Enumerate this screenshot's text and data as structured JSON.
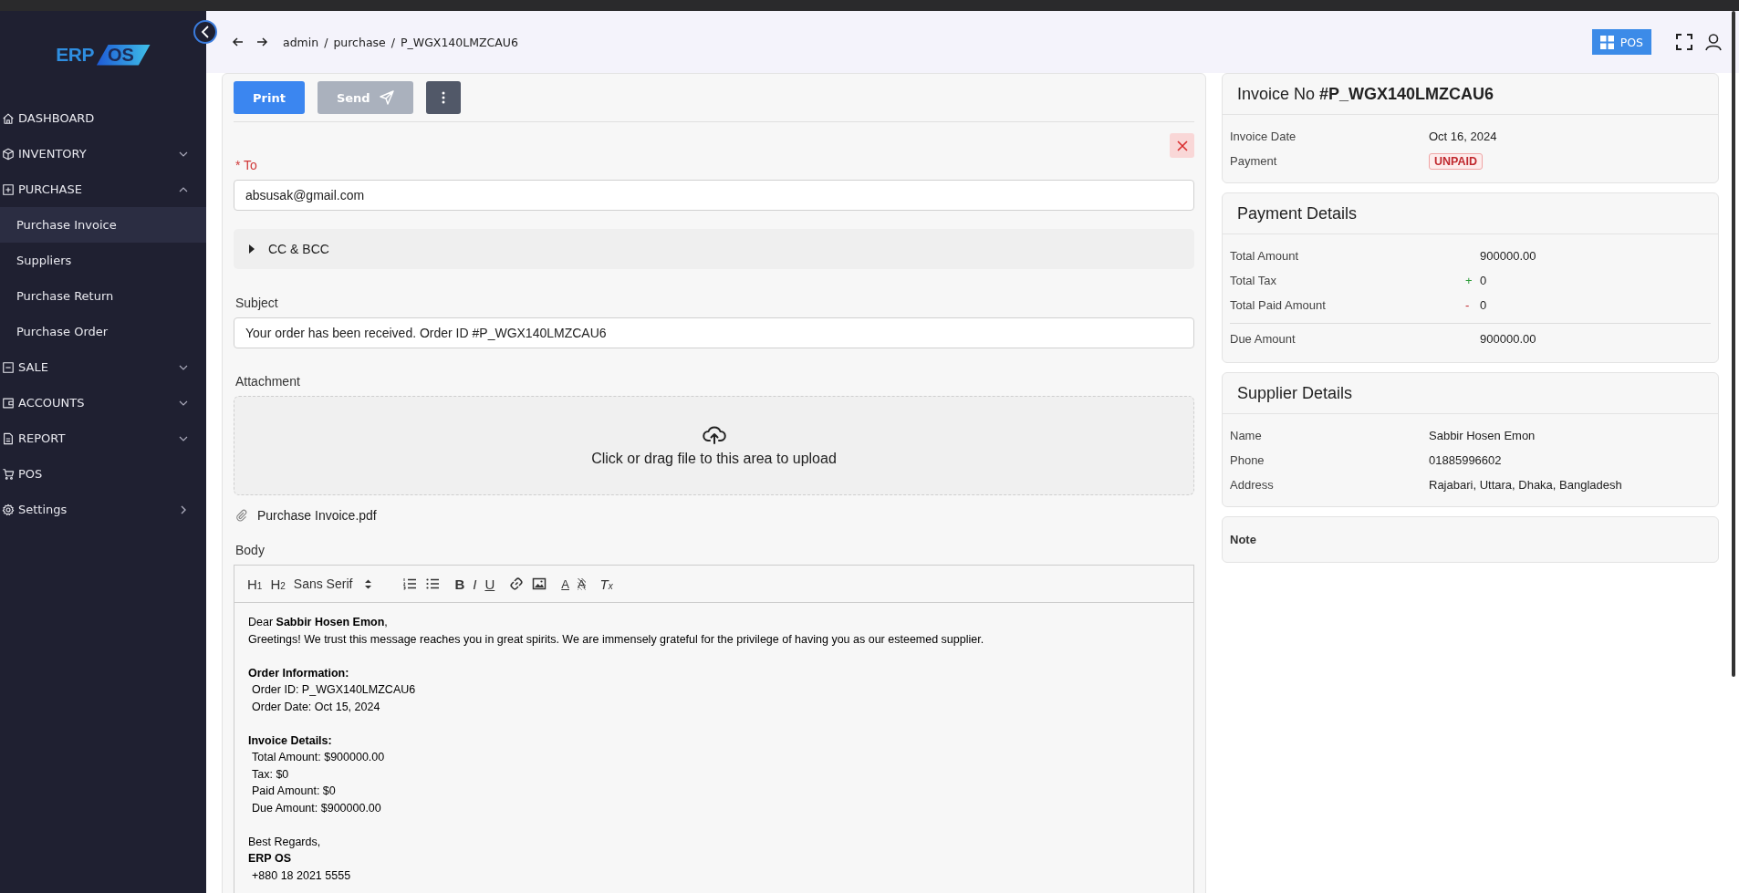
{
  "sidebar": {
    "logo": [
      "ERP",
      "OS"
    ],
    "items": [
      {
        "label": "DASHBOARD",
        "kind": "link"
      },
      {
        "label": "INVENTORY",
        "kind": "group",
        "expanded": false
      },
      {
        "label": "PURCHASE",
        "kind": "group",
        "expanded": true,
        "children": [
          {
            "label": "Purchase Invoice",
            "selected": true
          },
          {
            "label": "Suppliers",
            "selected": false
          },
          {
            "label": "Purchase Return",
            "selected": false
          },
          {
            "label": "Purchase Order",
            "selected": false
          }
        ]
      },
      {
        "label": "SALE",
        "kind": "group",
        "expanded": false
      },
      {
        "label": "ACCOUNTS",
        "kind": "group",
        "expanded": false
      },
      {
        "label": "REPORT",
        "kind": "group",
        "expanded": false
      },
      {
        "label": "POS",
        "kind": "link"
      },
      {
        "label": "Settings",
        "kind": "flyout"
      }
    ]
  },
  "topbar": {
    "breadcrumb": [
      "admin",
      "purchase",
      "P_WGX140LMZCAU6"
    ],
    "breadcrumb_separator": "/",
    "pos_button": "POS"
  },
  "actions": {
    "print": "Print",
    "send": {
      "label": "Send",
      "disabled": true
    }
  },
  "form": {
    "to_label": "To",
    "to_required": true,
    "required_mark": "*",
    "to_value": "absusak@gmail.com",
    "cc": {
      "label": "CC & BCC",
      "expanded": false
    },
    "subject_label": "Subject",
    "subject_value": "Your order has been received. Order ID #P_WGX140LMZCAU6",
    "attachment_label": "Attachment",
    "upload_text": "Click or drag file to this area to upload",
    "attached_file": "Purchase Invoice.pdf",
    "body_label": "Body",
    "toolbar": [
      [
        {
          "kind": "heading",
          "label": "H$_{1}$"
        },
        {
          "kind": "heading",
          "label": "H$_{2}$"
        },
        {
          "kind": "select",
          "label": "Sans Serif"
        }
      ],
      [
        {
          "kind": "ordered-list"
        },
        {
          "kind": "bullet-list"
        }
      ],
      [
        {
          "kind": "bold",
          "label": "B"
        },
        {
          "kind": "italic",
          "label": "I"
        },
        {
          "kind": "underline",
          "label": "U"
        }
      ],
      [
        {
          "kind": "link"
        },
        {
          "kind": "image"
        }
      ],
      [
        {
          "kind": "color",
          "label": "A"
        },
        {
          "kind": "background",
          "label": "A"
        }
      ],
      [
        {
          "kind": "clean",
          "label": "T$_{x}$"
        }
      ]
    ],
    "body": [
      [
        {
          "text": "Dear **Sabbir Hosen Emon**,",
          "bold": false,
          "indented": false
        },
        {
          "text": "Greetings! We trust this message reaches you in great spirits. We are immensely grateful for the privilege of having you as our esteemed supplier.",
          "bold": false,
          "indented": false
        }
      ],
      [
        {
          "text": "Order Information:",
          "bold": true,
          "indented": false
        },
        {
          "text": "Order ID: P_WGX140LMZCAU6",
          "bold": false,
          "indented": true
        },
        {
          "text": "Order Date: Oct 15, 2024",
          "bold": false,
          "indented": true
        }
      ],
      [
        {
          "text": "Invoice Details:",
          "bold": true,
          "indented": false
        },
        {
          "text": "Total Amount: $900000.00",
          "bold": false,
          "indented": true
        },
        {
          "text": "Tax: $0",
          "bold": false,
          "indented": true
        },
        {
          "text": "Paid Amount: $0",
          "bold": false,
          "indented": true
        },
        {
          "text": "Due Amount: $900000.00",
          "bold": false,
          "indented": true
        }
      ],
      [
        {
          "text": "Best Regards,",
          "bold": false,
          "indented": false
        },
        {
          "text": "ERP OS",
          "bold": true,
          "indented": false
        },
        {
          "text": "+880 18 2021 5555",
          "bold": false,
          "indented": true
        }
      ]
    ]
  },
  "invoice": {
    "title": "Invoice No **#P_WGX140LMZCAU6**",
    "rows": [
      {
        "label": "Invoice Date",
        "value": "Oct 16, 2024",
        "kind": "text"
      },
      {
        "label": "Payment",
        "value": "UNPAID",
        "kind": "badge"
      }
    ]
  },
  "payment_details": {
    "title": "Payment Details",
    "rows": [
      {
        "label": "Total Amount",
        "value": "900000.00",
        "kind": "plain"
      },
      {
        "label": "Total Tax",
        "value": "0",
        "kind": "add",
        "sign": "+"
      },
      {
        "label": "Total Paid Amount",
        "value": "0",
        "kind": "subtract",
        "sign": "-"
      },
      {
        "label": "Due Amount",
        "value": "900000.00",
        "kind": "total"
      }
    ]
  },
  "supplier": {
    "title": "Supplier Details",
    "rows": [
      {
        "label": "Name",
        "value": "Sabbir Hosen Emon"
      },
      {
        "label": "Phone",
        "value": "01885996602"
      },
      {
        "label": "Address",
        "value": "Rajabari, Uttara, Dhaka, Bangladesh"
      }
    ]
  },
  "note": {
    "label": "Note"
  }
}
